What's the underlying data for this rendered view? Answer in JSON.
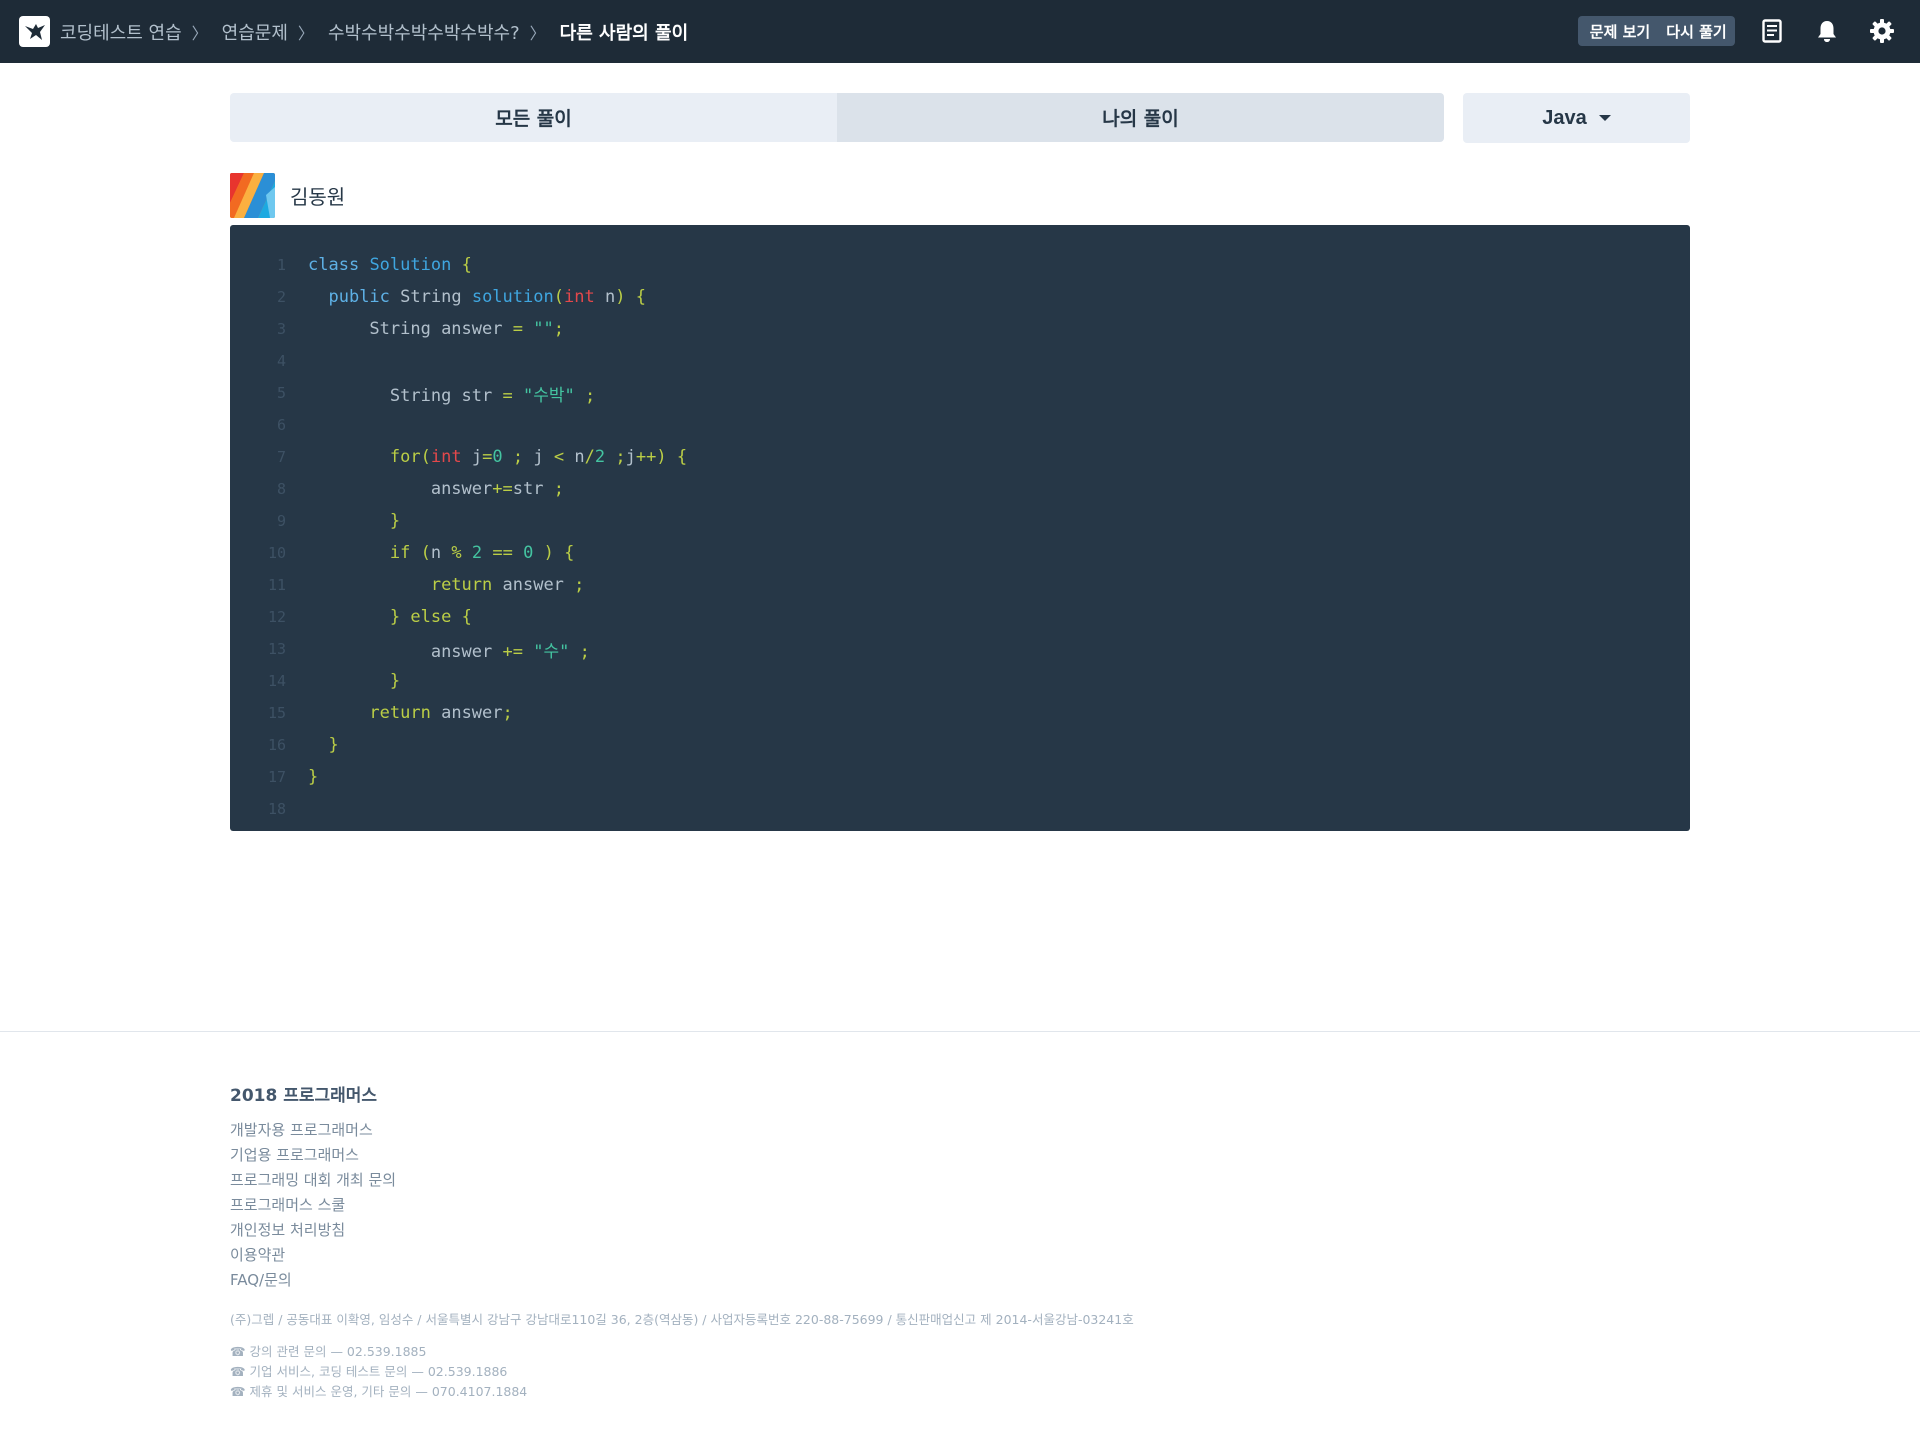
{
  "navbar": {
    "breadcrumb": [
      "코딩테스트 연습",
      "연습문제",
      "수박수박수박수박수박수?",
      "다른 사람의 풀이"
    ],
    "breadcrumb_separator": "〉",
    "view_problem_label": "문제 보기",
    "retry_label": "다시 풀기",
    "icons": [
      "programmers-logo-icon",
      "note-icon",
      "bell-icon",
      "gear-icon"
    ]
  },
  "tabs": {
    "all_solutions": "모든 풀이",
    "my_solutions": "나의 풀이"
  },
  "language": {
    "selected": "Java"
  },
  "solution": {
    "author": "김동원",
    "line_numbers": [
      "1",
      "2",
      "3",
      "4",
      "5",
      "6",
      "7",
      "8",
      "9",
      "10",
      "11",
      "12",
      "13",
      "14",
      "15",
      "16",
      "17",
      "18"
    ]
  },
  "footer": {
    "title": "2018 프로그래머스",
    "links": [
      "개발자용 프로그래머스",
      "기업용 프로그래머스",
      "프로그래밍 대회 개최 문의",
      "프로그래머스 스쿨",
      "개인정보 처리방침",
      "이용약관",
      "FAQ/문의"
    ],
    "address": "(주)그렙 / 공동대표 이확영, 임성수 / 서울특별시 강남구 강남대로110길 36, 2층(역삼동) / 사업자등록번호 220-88-75699 / 통신판매업신고 제 2014-서울강남-03241호",
    "contacts": [
      "☎ 강의 관련 문의 — 02.539.1885",
      "☎ 기업 서비스, 코딩 테스트 문의 — 02.539.1886",
      "☎ 제휴 및 서비스 운영, 기타 문의 — 070.4107.1884"
    ]
  },
  "colors": {
    "navbar_bg": "#1e2b37",
    "code_bg": "#263747",
    "tab_bg": "#e9eef5",
    "tab_active_bg": "#dbe2ea",
    "button_group_bg": "#44576c"
  }
}
